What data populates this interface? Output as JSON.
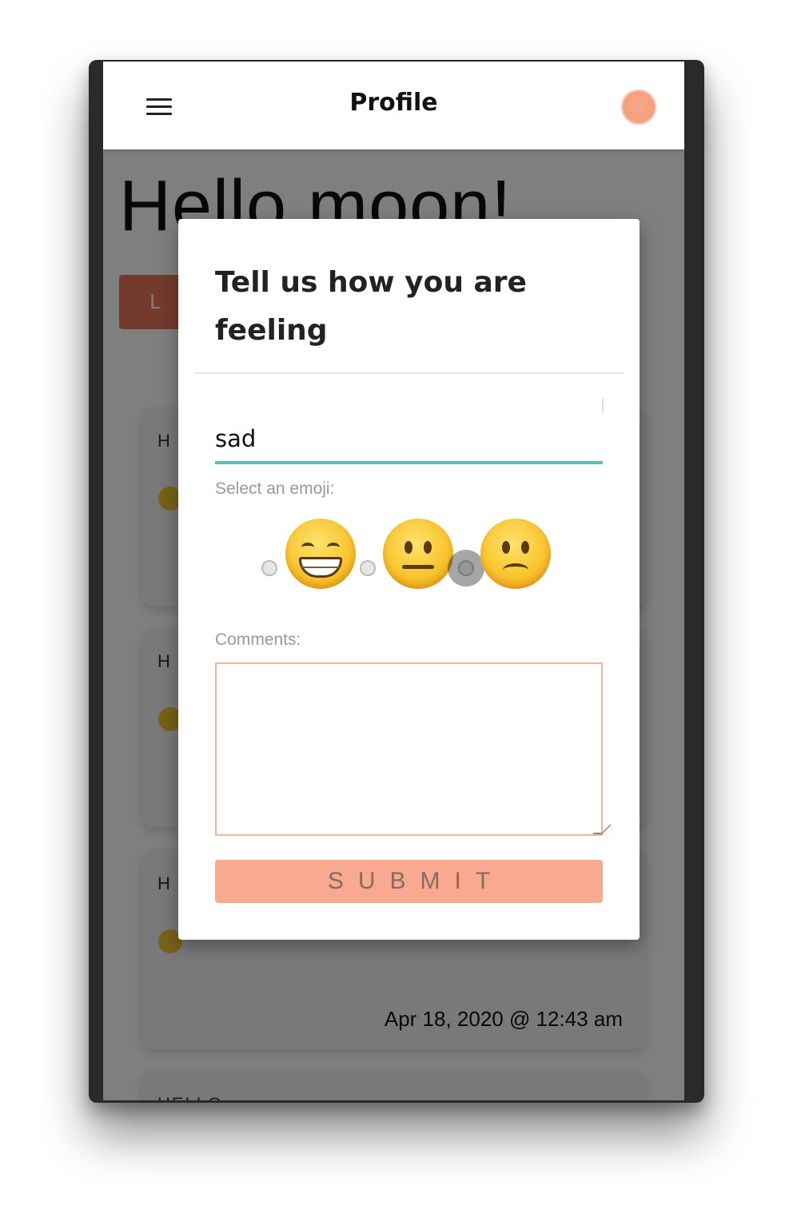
{
  "app_bar": {
    "title": "Profile",
    "menu_icon": "hamburger-menu-icon",
    "avatar_icon": "avatar"
  },
  "page": {
    "greeting": "Hello moon!",
    "button_label": "L"
  },
  "cards": [
    {
      "heading": "H"
    },
    {
      "heading": "H"
    },
    {
      "heading": "H",
      "date": "Apr 18, 2020 @ 12:43 am"
    },
    {
      "heading": "HELLO"
    }
  ],
  "modal": {
    "title": "Tell us how you are feeling",
    "feeling_value": "sad",
    "emoji_label": "Select an emoji:",
    "emoji_options": [
      {
        "name": "grinning-face",
        "selected": false
      },
      {
        "name": "neutral-face",
        "selected": false
      },
      {
        "name": "frowning-face",
        "selected": true
      }
    ],
    "comments_label": "Comments:",
    "comments_value": "",
    "submit_label": "SUBMIT"
  },
  "colors": {
    "accent_teal": "#5fbdb8",
    "accent_salmon": "#f9a98f",
    "overlay": "rgba(0,0,0,0.5)"
  }
}
